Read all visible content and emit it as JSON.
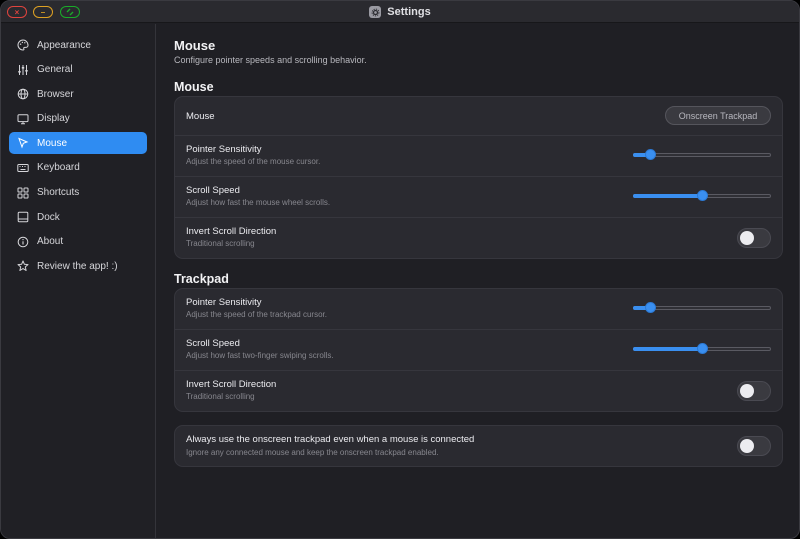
{
  "window": {
    "title": "Settings",
    "app_icon": "gear-icon"
  },
  "sidebar": {
    "items": [
      {
        "label": "Appearance",
        "icon": "palette-icon"
      },
      {
        "label": "General",
        "icon": "sliders-icon"
      },
      {
        "label": "Browser",
        "icon": "globe-icon"
      },
      {
        "label": "Display",
        "icon": "monitor-icon"
      },
      {
        "label": "Mouse",
        "icon": "cursor-icon",
        "active": true
      },
      {
        "label": "Keyboard",
        "icon": "keyboard-icon"
      },
      {
        "label": "Shortcuts",
        "icon": "grid-icon"
      },
      {
        "label": "Dock",
        "icon": "dock-icon"
      },
      {
        "label": "About",
        "icon": "info-icon"
      },
      {
        "label": "Review the app! :)",
        "icon": "star-icon"
      }
    ]
  },
  "page": {
    "title": "Mouse",
    "subtitle": "Configure pointer speeds and scrolling behavior."
  },
  "mouse_section": {
    "title": "Mouse",
    "device_row": {
      "label": "Mouse",
      "button": "Onscreen Trackpad"
    },
    "pointer_sensitivity": {
      "label": "Pointer Sensitivity",
      "desc": "Adjust the speed of the mouse cursor.",
      "value": 0.13
    },
    "scroll_speed": {
      "label": "Scroll Speed",
      "desc": "Adjust how fast the mouse wheel scrolls.",
      "value": 0.5
    },
    "invert_scroll": {
      "label": "Invert Scroll Direction",
      "desc": "Traditional scrolling",
      "on": false
    }
  },
  "trackpad_section": {
    "title": "Trackpad",
    "pointer_sensitivity": {
      "label": "Pointer Sensitivity",
      "desc": "Adjust the speed of the trackpad cursor.",
      "value": 0.13
    },
    "scroll_speed": {
      "label": "Scroll Speed",
      "desc": "Adjust how fast two-finger swiping scrolls.",
      "value": 0.5
    },
    "invert_scroll": {
      "label": "Invert Scroll Direction",
      "desc": "Traditional scrolling",
      "on": false
    }
  },
  "onscreen_option": {
    "label": "Always use the onscreen trackpad even when a mouse is connected",
    "desc": "Ignore any connected mouse and keep the onscreen trackpad enabled.",
    "on": false
  },
  "colors": {
    "accent": "#2f8cf2",
    "background": "#1f1f24",
    "card": "#2a2a30"
  }
}
